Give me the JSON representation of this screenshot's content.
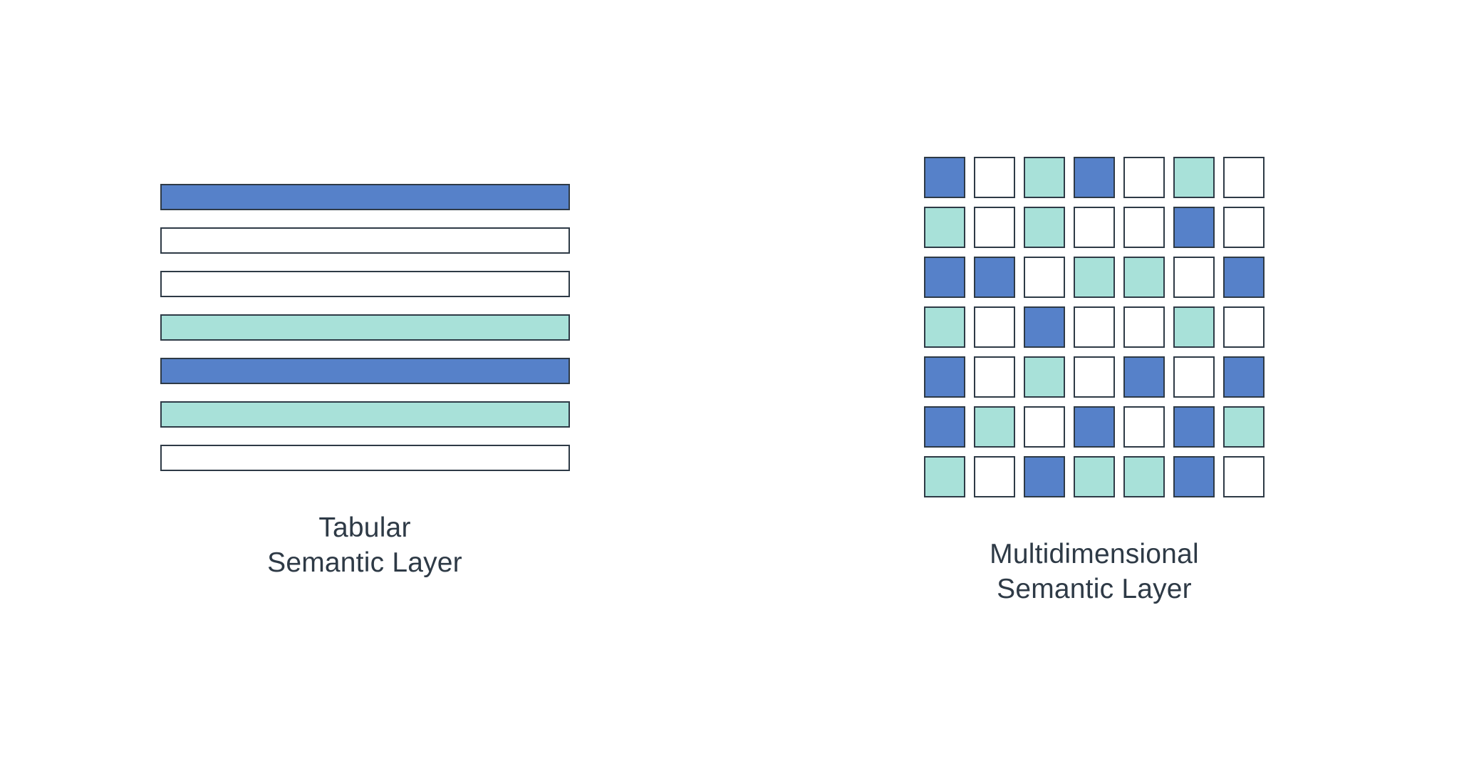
{
  "colors": {
    "blue": "#5681c9",
    "teal": "#a8e1d9",
    "white": "#ffffff",
    "stroke": "#2e3a46"
  },
  "left": {
    "title_line1": "Tabular",
    "title_line2": "Semantic Layer",
    "rows": [
      "blue",
      "white",
      "white",
      "teal",
      "blue",
      "teal",
      "white"
    ]
  },
  "right": {
    "title_line1": "Multidimensional",
    "title_line2": "Semantic Layer",
    "grid": [
      [
        "blue",
        "white",
        "teal",
        "blue",
        "white",
        "teal",
        "white"
      ],
      [
        "teal",
        "white",
        "teal",
        "white",
        "white",
        "blue",
        "white"
      ],
      [
        "blue",
        "blue",
        "white",
        "teal",
        "teal",
        "white",
        "blue"
      ],
      [
        "teal",
        "white",
        "blue",
        "white",
        "white",
        "teal",
        "white"
      ],
      [
        "blue",
        "white",
        "teal",
        "white",
        "blue",
        "white",
        "blue"
      ],
      [
        "blue",
        "teal",
        "white",
        "blue",
        "white",
        "blue",
        "teal"
      ],
      [
        "teal",
        "white",
        "blue",
        "teal",
        "teal",
        "blue",
        "white"
      ]
    ]
  }
}
